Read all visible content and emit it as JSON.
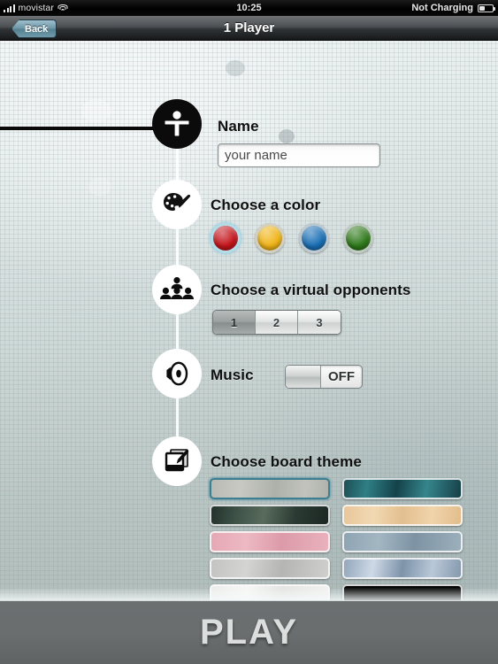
{
  "statusbar": {
    "carrier": "movistar",
    "time": "10:25",
    "battery_status": "Not Charging",
    "signal_icon": "signal-bars-icon",
    "wifi_icon": "wifi-icon",
    "battery_icon": "battery-icon"
  },
  "navbar": {
    "back_label": "Back",
    "title": "1 Player"
  },
  "sections": {
    "name": {
      "icon": "person-icon",
      "label": "Name",
      "input_placeholder": "your name",
      "input_value": ""
    },
    "color": {
      "icon": "palette-icon",
      "label": "Choose a color",
      "swatches": [
        {
          "name": "red",
          "hex": "#c4161c",
          "selected": true
        },
        {
          "name": "yellow",
          "hex": "#f0b417",
          "selected": false
        },
        {
          "name": "blue",
          "hex": "#1a6fb5",
          "selected": false
        },
        {
          "name": "green",
          "hex": "#2f7a1b",
          "selected": false
        }
      ],
      "selection_ring_hex": "#b5dde8"
    },
    "opponents": {
      "icon": "people-group-icon",
      "label": "Choose a virtual opponents",
      "options": [
        "1",
        "2",
        "3"
      ],
      "selected": "1"
    },
    "music": {
      "icon": "speaker-icon",
      "label": "Music",
      "toggle_state": "OFF"
    },
    "theme": {
      "icon": "board-brush-icon",
      "label": "Choose board theme",
      "items": [
        {
          "name": "concrete-gray",
          "selected": true,
          "css": "linear-gradient(95deg,#b9bab4 0%,#c8c9c2 25%,#aeb0aa 55%,#c2c3bd 80%,#b0b2ac 100%)"
        },
        {
          "name": "teal-swirl",
          "selected": false,
          "css": "linear-gradient(100deg,#1d4f55 0%,#2f7f85 20%,#14424a 45%,#35868c 70%,#173f47 100%)"
        },
        {
          "name": "dark-forest",
          "selected": false,
          "css": "linear-gradient(100deg,#23312c 0%,#3e5248 22%,#586b5c 45%,#2a3a33 72%,#1c2723 100%)"
        },
        {
          "name": "light-wood",
          "selected": false,
          "css": "linear-gradient(95deg,#e8c69a 0%,#f2d9b3 25%,#e3bf8f 50%,#f0d4ab 75%,#e2bd8c 100%)"
        },
        {
          "name": "pink-circuit",
          "selected": false,
          "css": "linear-gradient(95deg,#e5a8b4 0%,#edb9c3 30%,#dd9aa8 60%,#e9b2bd 100%)"
        },
        {
          "name": "blue-gravel",
          "selected": false,
          "css": "linear-gradient(95deg,#8fa4b3 0%,#a3b6c2 30%,#7d93a4 60%,#9cafbb 100%)"
        },
        {
          "name": "gray-brushed",
          "selected": false,
          "css": "linear-gradient(100deg,#c3c4c2 0%,#d4d5d3 30%,#b5b6b4 60%,#cfd0ce 100%)"
        },
        {
          "name": "blue-marble",
          "selected": false,
          "css": "linear-gradient(100deg,#93a6bb 0%,#cdd9e6 25%,#7e93aa 50%,#b9c8d8 75%,#8598ad 100%)"
        },
        {
          "name": "white-weave",
          "selected": false,
          "css": "linear-gradient(95deg,#ececea 0%,#f7f7f5 30%,#e4e4e2 60%,#f2f2f0 100%)"
        },
        {
          "name": "solid-black",
          "selected": false,
          "css": "linear-gradient(#000,#000)"
        }
      ]
    }
  },
  "play_button": {
    "label": "PLAY"
  }
}
